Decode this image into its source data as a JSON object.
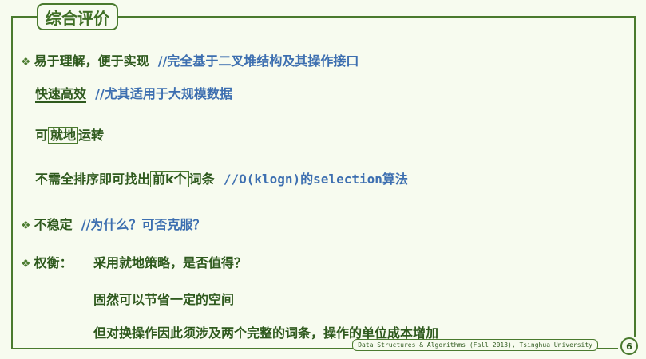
{
  "title": "综合评价",
  "items": {
    "i1": {
      "text": "易于理解，便于实现",
      "comment": "//完全基于二叉堆结构及其操作接口"
    },
    "i2": {
      "text": "快速高效",
      "comment": "//尤其适用于大规模数据"
    },
    "i3": {
      "pre": "可",
      "boxed": "就地",
      "post": "运转"
    },
    "i4": {
      "pre": "不需全排序即可找出",
      "boxed": "前k个",
      "post": "词条",
      "comment_pre": "//O(klogn)的",
      "comment_code": "selection",
      "comment_post": "算法"
    },
    "i5": {
      "text": "不稳定",
      "comment": "//为什么？可否克服？"
    },
    "i6": {
      "label": "权衡：",
      "text": "采用就地策略，是否值得？"
    },
    "i7": {
      "text": "固然可以节省一定的空间"
    },
    "i8": {
      "text": "但对换操作因此须涉及两个完整的词条，操作的单位成本增加"
    }
  },
  "footer": "Data Structures & Algorithms (Fall 2013), Tsinghua University",
  "page_number": "6",
  "colors": {
    "accent_green": "#4a7a2e",
    "text_green": "#2f5a1e",
    "comment_blue": "#3d6fb0",
    "background": "#f7fbef"
  }
}
